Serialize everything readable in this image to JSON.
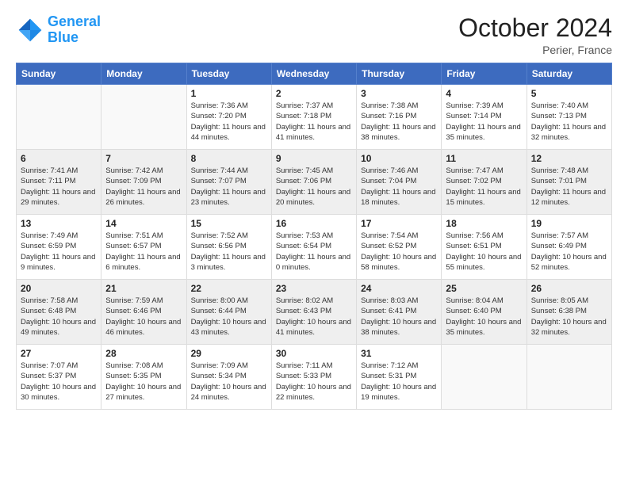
{
  "header": {
    "logo_line1": "General",
    "logo_line2": "Blue",
    "month": "October 2024",
    "location": "Perier, France"
  },
  "weekdays": [
    "Sunday",
    "Monday",
    "Tuesday",
    "Wednesday",
    "Thursday",
    "Friday",
    "Saturday"
  ],
  "weeks": [
    [
      {
        "day": "",
        "sunrise": "",
        "sunset": "",
        "daylight": ""
      },
      {
        "day": "",
        "sunrise": "",
        "sunset": "",
        "daylight": ""
      },
      {
        "day": "1",
        "sunrise": "Sunrise: 7:36 AM",
        "sunset": "Sunset: 7:20 PM",
        "daylight": "Daylight: 11 hours and 44 minutes."
      },
      {
        "day": "2",
        "sunrise": "Sunrise: 7:37 AM",
        "sunset": "Sunset: 7:18 PM",
        "daylight": "Daylight: 11 hours and 41 minutes."
      },
      {
        "day": "3",
        "sunrise": "Sunrise: 7:38 AM",
        "sunset": "Sunset: 7:16 PM",
        "daylight": "Daylight: 11 hours and 38 minutes."
      },
      {
        "day": "4",
        "sunrise": "Sunrise: 7:39 AM",
        "sunset": "Sunset: 7:14 PM",
        "daylight": "Daylight: 11 hours and 35 minutes."
      },
      {
        "day": "5",
        "sunrise": "Sunrise: 7:40 AM",
        "sunset": "Sunset: 7:13 PM",
        "daylight": "Daylight: 11 hours and 32 minutes."
      }
    ],
    [
      {
        "day": "6",
        "sunrise": "Sunrise: 7:41 AM",
        "sunset": "Sunset: 7:11 PM",
        "daylight": "Daylight: 11 hours and 29 minutes."
      },
      {
        "day": "7",
        "sunrise": "Sunrise: 7:42 AM",
        "sunset": "Sunset: 7:09 PM",
        "daylight": "Daylight: 11 hours and 26 minutes."
      },
      {
        "day": "8",
        "sunrise": "Sunrise: 7:44 AM",
        "sunset": "Sunset: 7:07 PM",
        "daylight": "Daylight: 11 hours and 23 minutes."
      },
      {
        "day": "9",
        "sunrise": "Sunrise: 7:45 AM",
        "sunset": "Sunset: 7:06 PM",
        "daylight": "Daylight: 11 hours and 20 minutes."
      },
      {
        "day": "10",
        "sunrise": "Sunrise: 7:46 AM",
        "sunset": "Sunset: 7:04 PM",
        "daylight": "Daylight: 11 hours and 18 minutes."
      },
      {
        "day": "11",
        "sunrise": "Sunrise: 7:47 AM",
        "sunset": "Sunset: 7:02 PM",
        "daylight": "Daylight: 11 hours and 15 minutes."
      },
      {
        "day": "12",
        "sunrise": "Sunrise: 7:48 AM",
        "sunset": "Sunset: 7:01 PM",
        "daylight": "Daylight: 11 hours and 12 minutes."
      }
    ],
    [
      {
        "day": "13",
        "sunrise": "Sunrise: 7:49 AM",
        "sunset": "Sunset: 6:59 PM",
        "daylight": "Daylight: 11 hours and 9 minutes."
      },
      {
        "day": "14",
        "sunrise": "Sunrise: 7:51 AM",
        "sunset": "Sunset: 6:57 PM",
        "daylight": "Daylight: 11 hours and 6 minutes."
      },
      {
        "day": "15",
        "sunrise": "Sunrise: 7:52 AM",
        "sunset": "Sunset: 6:56 PM",
        "daylight": "Daylight: 11 hours and 3 minutes."
      },
      {
        "day": "16",
        "sunrise": "Sunrise: 7:53 AM",
        "sunset": "Sunset: 6:54 PM",
        "daylight": "Daylight: 11 hours and 0 minutes."
      },
      {
        "day": "17",
        "sunrise": "Sunrise: 7:54 AM",
        "sunset": "Sunset: 6:52 PM",
        "daylight": "Daylight: 10 hours and 58 minutes."
      },
      {
        "day": "18",
        "sunrise": "Sunrise: 7:56 AM",
        "sunset": "Sunset: 6:51 PM",
        "daylight": "Daylight: 10 hours and 55 minutes."
      },
      {
        "day": "19",
        "sunrise": "Sunrise: 7:57 AM",
        "sunset": "Sunset: 6:49 PM",
        "daylight": "Daylight: 10 hours and 52 minutes."
      }
    ],
    [
      {
        "day": "20",
        "sunrise": "Sunrise: 7:58 AM",
        "sunset": "Sunset: 6:48 PM",
        "daylight": "Daylight: 10 hours and 49 minutes."
      },
      {
        "day": "21",
        "sunrise": "Sunrise: 7:59 AM",
        "sunset": "Sunset: 6:46 PM",
        "daylight": "Daylight: 10 hours and 46 minutes."
      },
      {
        "day": "22",
        "sunrise": "Sunrise: 8:00 AM",
        "sunset": "Sunset: 6:44 PM",
        "daylight": "Daylight: 10 hours and 43 minutes."
      },
      {
        "day": "23",
        "sunrise": "Sunrise: 8:02 AM",
        "sunset": "Sunset: 6:43 PM",
        "daylight": "Daylight: 10 hours and 41 minutes."
      },
      {
        "day": "24",
        "sunrise": "Sunrise: 8:03 AM",
        "sunset": "Sunset: 6:41 PM",
        "daylight": "Daylight: 10 hours and 38 minutes."
      },
      {
        "day": "25",
        "sunrise": "Sunrise: 8:04 AM",
        "sunset": "Sunset: 6:40 PM",
        "daylight": "Daylight: 10 hours and 35 minutes."
      },
      {
        "day": "26",
        "sunrise": "Sunrise: 8:05 AM",
        "sunset": "Sunset: 6:38 PM",
        "daylight": "Daylight: 10 hours and 32 minutes."
      }
    ],
    [
      {
        "day": "27",
        "sunrise": "Sunrise: 7:07 AM",
        "sunset": "Sunset: 5:37 PM",
        "daylight": "Daylight: 10 hours and 30 minutes."
      },
      {
        "day": "28",
        "sunrise": "Sunrise: 7:08 AM",
        "sunset": "Sunset: 5:35 PM",
        "daylight": "Daylight: 10 hours and 27 minutes."
      },
      {
        "day": "29",
        "sunrise": "Sunrise: 7:09 AM",
        "sunset": "Sunset: 5:34 PM",
        "daylight": "Daylight: 10 hours and 24 minutes."
      },
      {
        "day": "30",
        "sunrise": "Sunrise: 7:11 AM",
        "sunset": "Sunset: 5:33 PM",
        "daylight": "Daylight: 10 hours and 22 minutes."
      },
      {
        "day": "31",
        "sunrise": "Sunrise: 7:12 AM",
        "sunset": "Sunset: 5:31 PM",
        "daylight": "Daylight: 10 hours and 19 minutes."
      },
      {
        "day": "",
        "sunrise": "",
        "sunset": "",
        "daylight": ""
      },
      {
        "day": "",
        "sunrise": "",
        "sunset": "",
        "daylight": ""
      }
    ]
  ]
}
